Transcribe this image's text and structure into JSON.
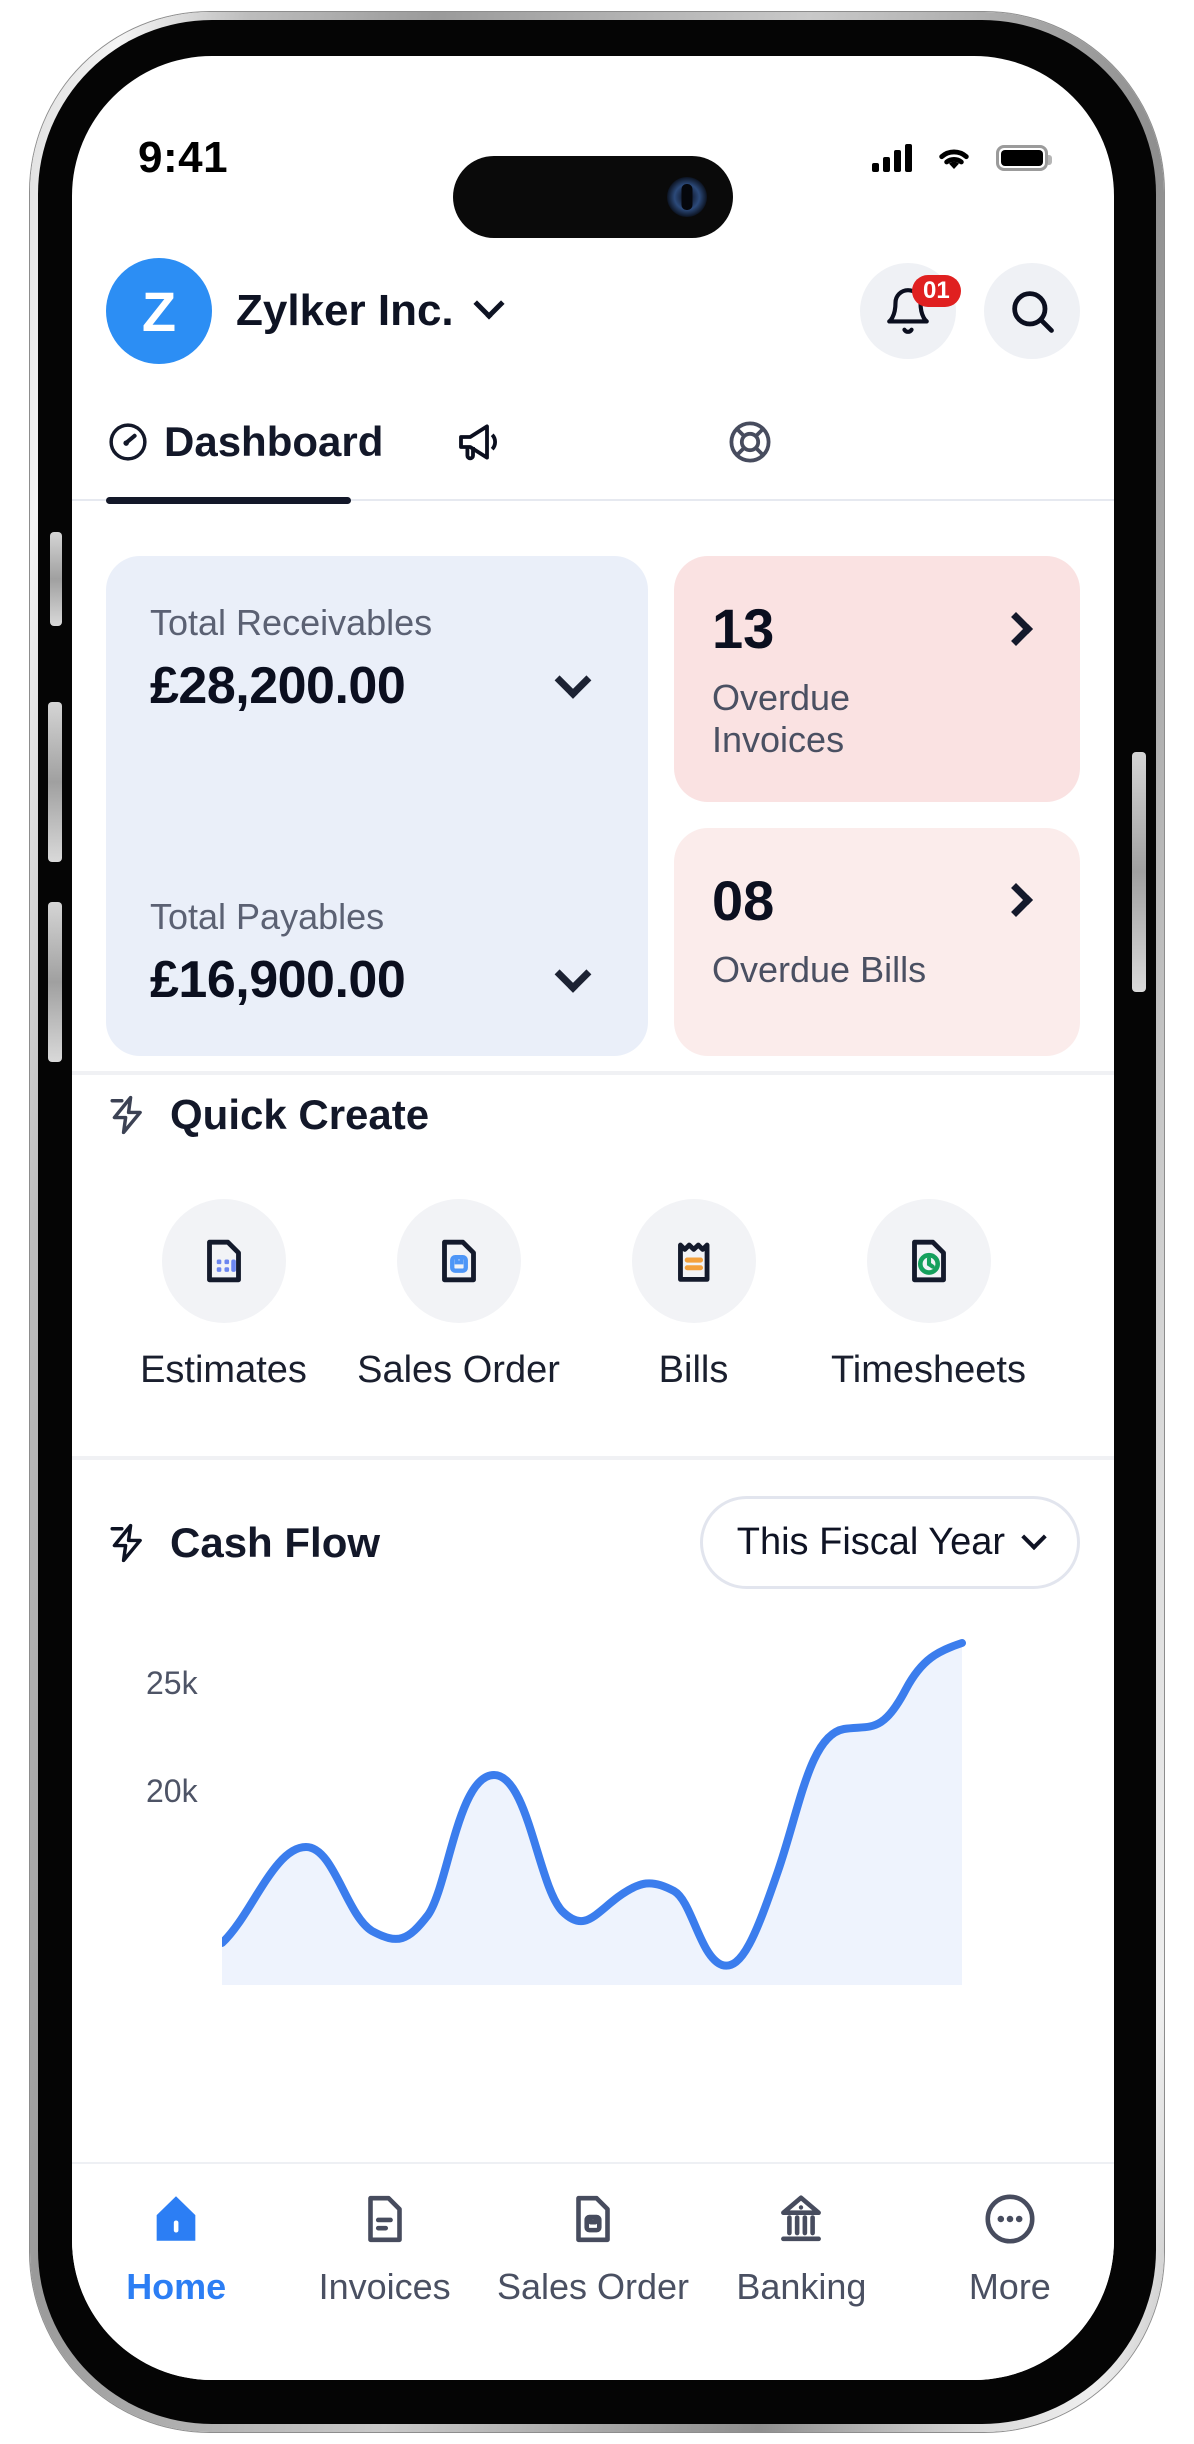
{
  "status_bar": {
    "time": "9:41",
    "icons": [
      "cellular-signal-icon",
      "wifi-icon",
      "battery-icon"
    ]
  },
  "header": {
    "avatar_initial": "Z",
    "org_name": "Zylker Inc.",
    "org_chevron_icon": "chevron-down-icon",
    "notification_badge": "01",
    "bell_icon": "bell-icon",
    "search_icon": "search-icon"
  },
  "tabs": [
    {
      "label": "Dashboard",
      "icon": "speedometer-icon",
      "active": true
    },
    {
      "label": "",
      "icon": "megaphone-icon",
      "active": false
    },
    {
      "label": "",
      "icon": "lifebuoy-icon",
      "active": false
    }
  ],
  "metrics": {
    "receivables": {
      "label": "Total Receivables",
      "value": "£28,200.00",
      "chevron_icon": "chevron-down-icon"
    },
    "payables": {
      "label": "Total Payables",
      "value": "£16,900.00",
      "chevron_icon": "chevron-down-icon"
    },
    "overdue_invoices": {
      "count": "13",
      "label": "Overdue Invoices",
      "arrow_icon": "chevron-right-icon",
      "bg": "#fae2e2"
    },
    "overdue_bills": {
      "count": "08",
      "label": "Overdue Bills",
      "arrow_icon": "chevron-right-icon",
      "bg": "#fbeceb"
    }
  },
  "quick_create": {
    "title": "Quick Create",
    "icon": "lightning-bolt-icon",
    "items": [
      {
        "label": "Estimates",
        "icon": "estimate-document-icon"
      },
      {
        "label": "Sales Order",
        "icon": "sales-order-document-icon"
      },
      {
        "label": "Bills",
        "icon": "bill-receipt-icon"
      },
      {
        "label": "Timesheets",
        "icon": "timesheet-clock-document-icon"
      }
    ]
  },
  "cash_flow": {
    "title": "Cash Flow",
    "icon": "lightning-bolt-icon",
    "period": "This Fiscal Year",
    "period_chevron_icon": "chevron-down-icon"
  },
  "chart_data": {
    "type": "area",
    "title": "Cash Flow",
    "xlabel": "",
    "ylabel": "",
    "ytick_labels": [
      "25k",
      "20k"
    ],
    "ytick_values": [
      25000,
      20000
    ],
    "ylim": [
      14000,
      27000
    ],
    "grid": false,
    "legend": "none",
    "line_color": "#3b7ded",
    "fill_color": "#eef3fd",
    "series": [
      {
        "name": "Cash Flow",
        "x": [
          0,
          1,
          2,
          3,
          4,
          5,
          6,
          7,
          8,
          9,
          10,
          11
        ],
        "values": [
          14800,
          18700,
          15200,
          14900,
          21300,
          16500,
          17500,
          18500,
          14000,
          15000,
          24200,
          26800
        ]
      }
    ]
  },
  "bottom_nav": [
    {
      "label": "Home",
      "icon": "home-icon",
      "active": true
    },
    {
      "label": "Invoices",
      "icon": "invoice-document-icon",
      "active": false
    },
    {
      "label": "Sales Order",
      "icon": "sales-order-document-icon",
      "active": false
    },
    {
      "label": "Banking",
      "icon": "bank-icon",
      "active": false
    },
    {
      "label": "More",
      "icon": "more-ellipsis-icon",
      "active": false
    }
  ],
  "colors": {
    "accent": "#2c7ef4",
    "badge_red": "#e02020",
    "card_blue": "#eaeff9",
    "card_pink": "#fae2e2"
  }
}
